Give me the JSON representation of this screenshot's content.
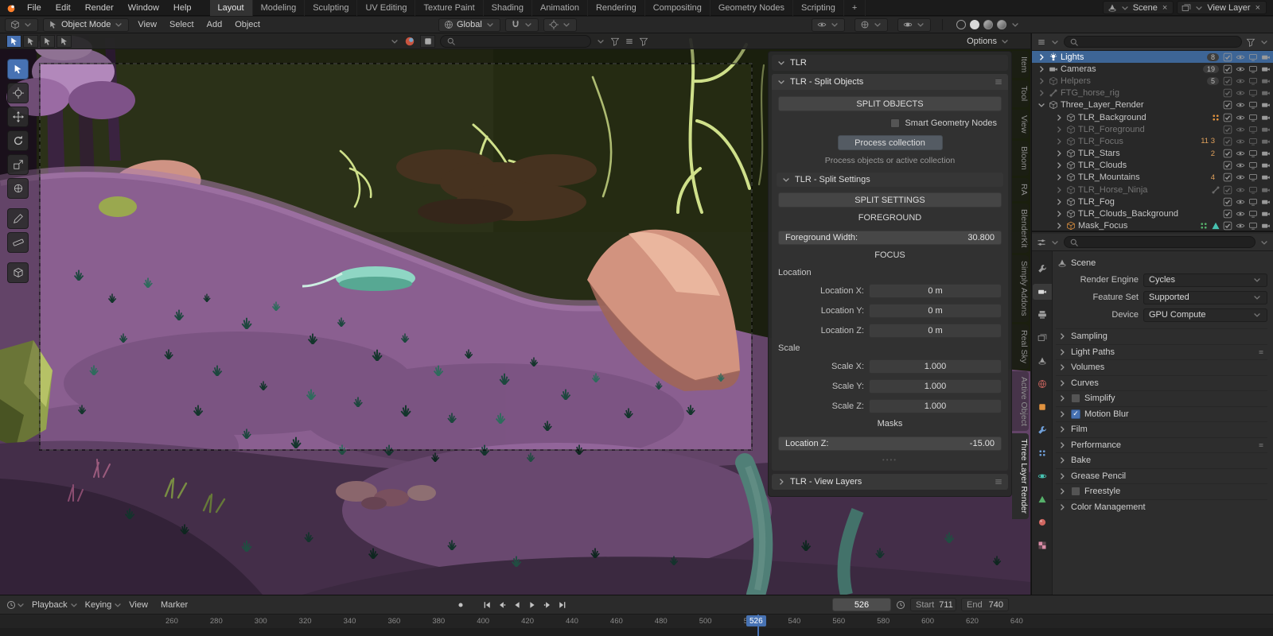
{
  "colors": {
    "accent": "#4772b3",
    "selection": "#3d6596",
    "topbar_bg": "#1b1b1b",
    "panel_bg": "#303030",
    "field_bg": "#3d3d3d",
    "button_bg": "#454545"
  },
  "scene_palette": {
    "background_olive": "#2b3118",
    "terrain_purple": "#8a5f90",
    "terrain_shadow": "#5f4166",
    "foliage_lime": "#cfe08a",
    "rock_salmon": "#d2937f",
    "rock_olive": "#93a24d",
    "grass_teal": "#1d473e",
    "root_teal": "#6fb0a5",
    "cloud_brown": "#46321f",
    "foliage_pink": "#b288bb"
  },
  "icons": {
    "search": "magnifier",
    "filter": "funnel",
    "menu": "hamburger",
    "visibility": "eye",
    "render_visibility": "camera",
    "viewport_visibility": "monitor",
    "checkbox": "check-square",
    "timeline_editor": "clock",
    "snapping": "magnet",
    "dropdown": "chevron-down"
  },
  "topbar": {
    "menus": [
      "File",
      "Edit",
      "Render",
      "Window",
      "Help"
    ],
    "workspaces": [
      "Layout",
      "Modeling",
      "Sculpting",
      "UV Editing",
      "Texture Paint",
      "Shading",
      "Animation",
      "Rendering",
      "Compositing",
      "Geometry Nodes",
      "Scripting"
    ],
    "add_workspace": "+",
    "scene_label": "Scene",
    "view_layer_label": "View Layer",
    "close": "×"
  },
  "viewport_header": {
    "mode": "Object Mode",
    "menus": [
      "View",
      "Select",
      "Add",
      "Object"
    ],
    "orientation": "Global",
    "options": "Options"
  },
  "tlr_panel": {
    "category": "TLR",
    "split_objects": {
      "header": "TLR - Split Objects",
      "button": "SPLIT OBJECTS",
      "smart_geo_label": "Smart Geometry Nodes",
      "process_button": "Process collection",
      "hint": "Process objects or active collection"
    },
    "split_settings": {
      "header": "TLR - Split Settings",
      "button": "SPLIT SETTINGS",
      "foreground_title": "FOREGROUND",
      "foreground_width": {
        "label": "Foreground Width:",
        "value": "30.800"
      },
      "focus_title": "FOCUS",
      "location_label": "Location",
      "location": [
        {
          "label": "Location X:",
          "value": "0 m"
        },
        {
          "label": "Location Y:",
          "value": "0 m"
        },
        {
          "label": "Location Z:",
          "value": "0 m"
        }
      ],
      "scale_label": "Scale",
      "scale": [
        {
          "label": "Scale X:",
          "value": "1.000"
        },
        {
          "label": "Scale Y:",
          "value": "1.000"
        },
        {
          "label": "Scale Z:",
          "value": "1.000"
        }
      ],
      "masks_title": "Masks",
      "mask_location": {
        "label": "Location Z:",
        "value": "-15.00"
      }
    },
    "view_layers_header": "TLR - View Layers"
  },
  "side_tabs": [
    "Item",
    "Tool",
    "View",
    "Bloom",
    "RA",
    "BlenderKit",
    "Simply Addons",
    "Real Sky",
    "Active Object",
    "Three Layer Render"
  ],
  "outliner": {
    "rows": [
      {
        "name": "Lights",
        "badge": "8"
      },
      {
        "name": "Cameras",
        "badge": "19"
      },
      {
        "name": "Helpers",
        "badge": "5"
      },
      {
        "name": "FTG_horse_rig"
      },
      {
        "name": "Three_Layer_Render"
      },
      {
        "name": "TLR_Background"
      },
      {
        "name": "TLR_Foreground"
      },
      {
        "name": "TLR_Focus",
        "badge": "11 3"
      },
      {
        "name": "TLR_Stars",
        "badge": "2"
      },
      {
        "name": "TLR_Clouds"
      },
      {
        "name": "TLR_Mountains",
        "badge": "4"
      },
      {
        "name": "TLR_Horse_Ninja"
      },
      {
        "name": "TLR_Fog"
      },
      {
        "name": "TLR_Clouds_Background"
      },
      {
        "name": "Mask_Focus"
      }
    ]
  },
  "properties": {
    "breadcrumb": "Scene",
    "fields": [
      {
        "label": "Render Engine",
        "value": "Cycles"
      },
      {
        "label": "Feature Set",
        "value": "Supported"
      },
      {
        "label": "Device",
        "value": "GPU Compute"
      }
    ],
    "sections": [
      {
        "label": "Sampling"
      },
      {
        "label": "Light Paths"
      },
      {
        "label": "Volumes"
      },
      {
        "label": "Curves"
      },
      {
        "label": "Simplify"
      },
      {
        "label": "Motion Blur"
      },
      {
        "label": "Film"
      },
      {
        "label": "Performance"
      },
      {
        "label": "Bake"
      },
      {
        "label": "Grease Pencil"
      },
      {
        "label": "Freestyle"
      },
      {
        "label": "Color Management"
      }
    ]
  },
  "timeline": {
    "menus": [
      "Playback",
      "Keying",
      "View",
      "Marker"
    ],
    "current_frame": "526",
    "start": {
      "label": "Start",
      "value": "711"
    },
    "end": {
      "label": "End",
      "value": "740"
    },
    "ticks": [
      "260",
      "280",
      "300",
      "320",
      "340",
      "360",
      "380",
      "400",
      "420",
      "440",
      "460",
      "480",
      "500",
      "520",
      "540",
      "560",
      "580",
      "600",
      "620",
      "640"
    ]
  }
}
